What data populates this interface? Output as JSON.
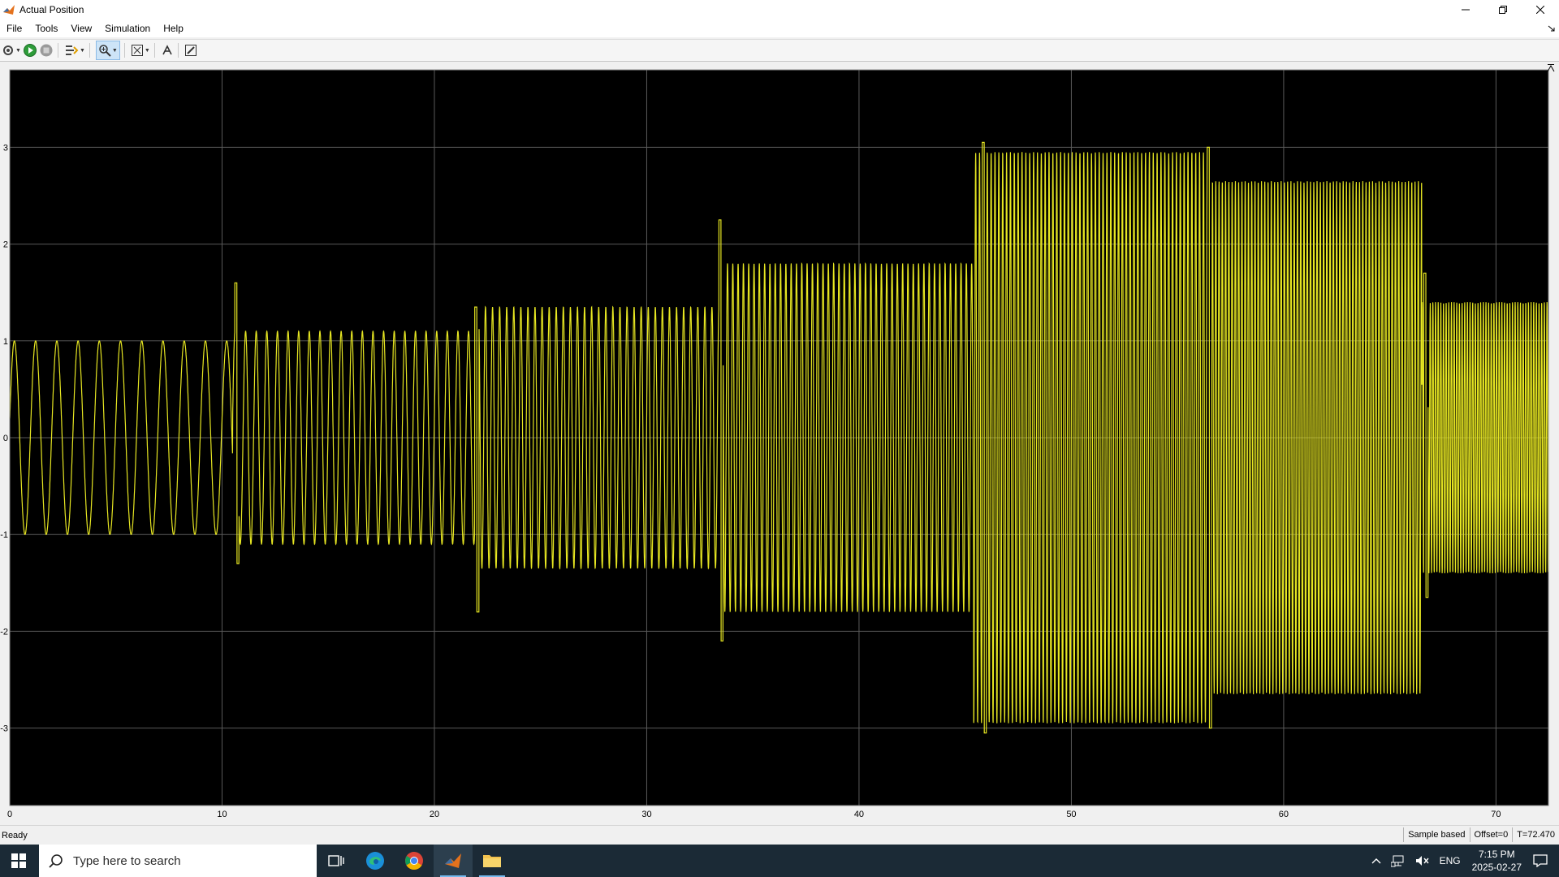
{
  "window": {
    "title": "Actual Position",
    "controls": [
      "minimize",
      "restore",
      "close"
    ]
  },
  "menu": [
    "File",
    "Tools",
    "View",
    "Simulation",
    "Help"
  ],
  "toolbar": {
    "buttons": [
      "settings-icon",
      "run-icon",
      "stop-icon",
      "highlight-icon",
      "zoom-icon",
      "fit-view-icon",
      "restore-layout-icon",
      "edit-icon"
    ]
  },
  "status": {
    "left": "Ready",
    "sample": "Sample based",
    "offset": "Offset=0",
    "time": "T=72.470"
  },
  "taskbar": {
    "search_placeholder": "Type here to search",
    "lang": "ENG",
    "time": "7:15 PM",
    "date": "2025-02-27"
  },
  "colors": {
    "plot_bg": "#000000",
    "signal": "#e6e622",
    "grid": "#5a5a5a",
    "tick": "#ffffff"
  },
  "chart_data": {
    "type": "line",
    "title": "",
    "xlabel": "",
    "ylabel": "",
    "xlim": [
      0,
      72.47
    ],
    "ylim": [
      -3.8,
      3.8
    ],
    "xticks": [
      0,
      10,
      20,
      30,
      40,
      50,
      60,
      70
    ],
    "yticks": [
      -3,
      -2,
      -1,
      0,
      1,
      2,
      3
    ],
    "grid": true,
    "series": [
      {
        "segments": [
          {
            "t_start": 0,
            "t_end": 10.5,
            "amplitude": 1.0,
            "frequency": 1.0
          },
          {
            "t_start": 10.5,
            "t_end": 21.9,
            "amplitude": 1.1,
            "frequency": 2.0
          },
          {
            "t_start": 21.9,
            "t_end": 33.4,
            "amplitude": 1.35,
            "frequency": 3.0
          },
          {
            "t_start": 33.4,
            "t_end": 45.4,
            "amplitude": 1.8,
            "frequency": 4.0
          },
          {
            "t_start": 45.4,
            "t_end": 56.4,
            "amplitude": 2.95,
            "frequency": 5.5
          },
          {
            "t_start": 56.4,
            "t_end": 66.5,
            "amplitude": 2.65,
            "frequency": 6.5
          },
          {
            "t_start": 66.5,
            "t_end": 72.47,
            "amplitude": 1.4,
            "frequency": 8.0
          }
        ],
        "spikes": [
          {
            "t": 10.6,
            "peak": 1.6,
            "trough": -1.3
          },
          {
            "t": 21.9,
            "peak": 1.35,
            "trough": -1.8
          },
          {
            "t": 33.4,
            "peak": 2.25,
            "trough": -2.1
          },
          {
            "t": 45.8,
            "peak": 3.05,
            "trough": -3.05
          },
          {
            "t": 56.4,
            "peak": 3.0,
            "trough": -3.0
          },
          {
            "t": 66.6,
            "peak": 1.7,
            "trough": -1.65
          }
        ]
      }
    ]
  }
}
